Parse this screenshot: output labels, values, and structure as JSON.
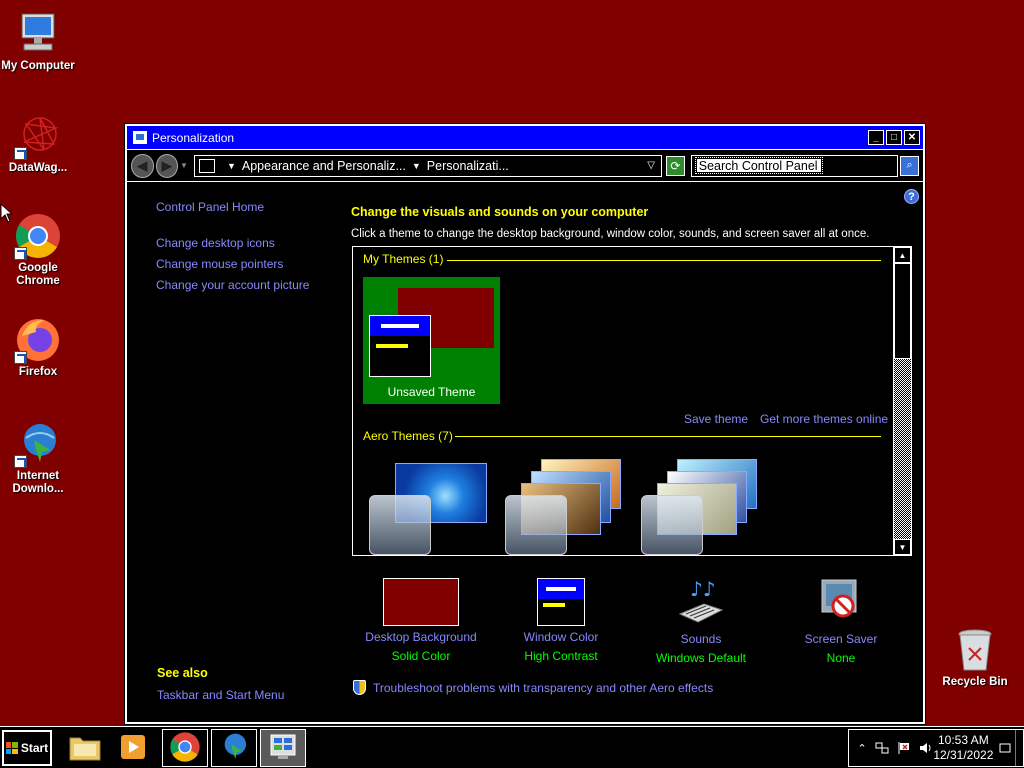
{
  "desktop": {
    "icons": [
      {
        "label": "My Computer"
      },
      {
        "label": "DataWag..."
      },
      {
        "label": "Google Chrome"
      },
      {
        "label": "Firefox"
      },
      {
        "label": "Internet Downlo..."
      },
      {
        "label": "Recycle Bin"
      }
    ]
  },
  "window": {
    "title": "Personalization",
    "buttons": {
      "minimize": "_",
      "maximize": "□",
      "close": "✕"
    },
    "address": {
      "crumb1": "Appearance and Personaliz...",
      "crumb2": "Personalizati..."
    },
    "search": {
      "value": "Search Control Panel"
    },
    "help": "?",
    "left_links": {
      "home": "Control Panel Home",
      "desktop_icons": "Change desktop icons",
      "mouse_pointers": "Change mouse pointers",
      "account_picture": "Change your account picture"
    },
    "see_also": {
      "heading": "See also",
      "taskbar": "Taskbar and Start Menu"
    },
    "main": {
      "heading": "Change the visuals and sounds on your computer",
      "subheading": "Click a theme to change the desktop background, window color, sounds, and screen saver all at once.",
      "my_themes": "My Themes (1)",
      "unsaved_theme": "Unsaved Theme",
      "save_theme": "Save theme",
      "get_more": "Get more themes online",
      "aero_themes": "Aero Themes (7)"
    },
    "bottom": {
      "background": {
        "label": "Desktop Background",
        "value": "Solid Color"
      },
      "color": {
        "label": "Window Color",
        "value": "High Contrast"
      },
      "sounds": {
        "label": "Sounds",
        "value": "Windows Default"
      },
      "screensaver": {
        "label": "Screen Saver",
        "value": "None"
      }
    },
    "troubleshoot": "Troubleshoot problems with transparency and other Aero effects"
  },
  "taskbar": {
    "start": "Start",
    "time": "10:53 AM",
    "date": "12/31/2022"
  },
  "colors": {
    "desktop": "#800000",
    "title": "#0000ff",
    "heading": "#ffff00",
    "link": "#8888ff",
    "value": "#00ff00"
  }
}
